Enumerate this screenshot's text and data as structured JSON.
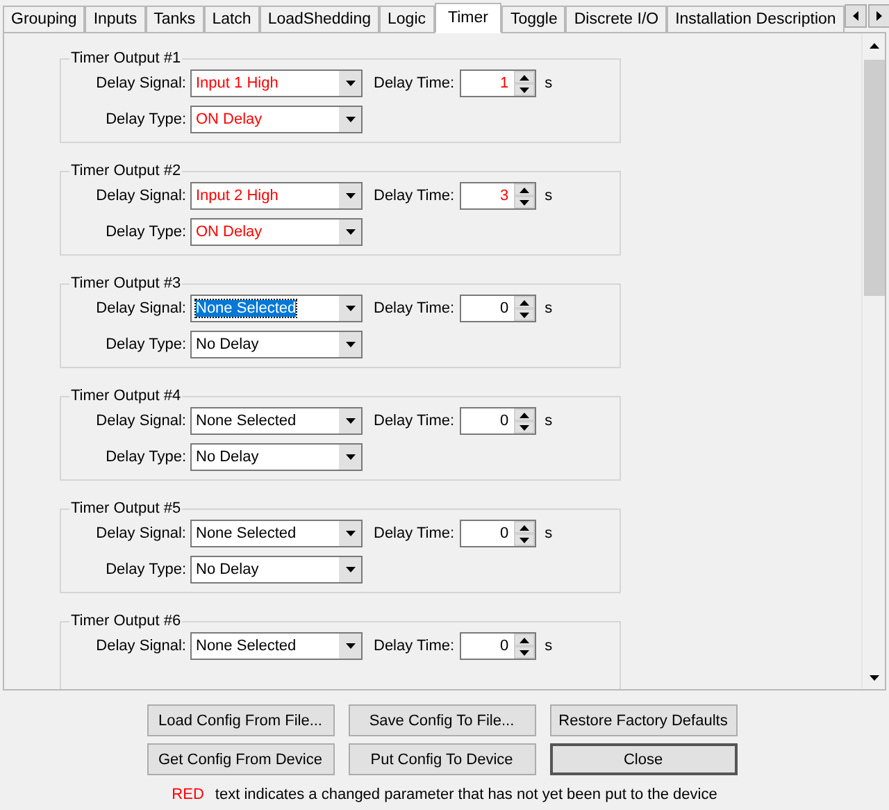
{
  "tabs": [
    {
      "label": "Grouping",
      "selected": false
    },
    {
      "label": "Inputs",
      "selected": false
    },
    {
      "label": "Tanks",
      "selected": false
    },
    {
      "label": "Latch",
      "selected": false
    },
    {
      "label": "LoadShedding",
      "selected": false
    },
    {
      "label": "Logic",
      "selected": false
    },
    {
      "label": "Timer",
      "selected": true
    },
    {
      "label": "Toggle",
      "selected": false
    },
    {
      "label": "Discrete I/O",
      "selected": false
    },
    {
      "label": "Installation Description",
      "selected": false
    }
  ],
  "timers": [
    {
      "title": "Timer Output #1",
      "signal_label": "Delay Signal:",
      "signal": {
        "value": "Input 1 High",
        "changed": true,
        "selected": false
      },
      "time_label": "Delay Time:",
      "time": {
        "value": "1",
        "changed": true
      },
      "unit": "s",
      "type_label": "Delay Type:",
      "type": {
        "value": "ON Delay",
        "changed": true
      }
    },
    {
      "title": "Timer Output #2",
      "signal_label": "Delay Signal:",
      "signal": {
        "value": "Input 2 High",
        "changed": true,
        "selected": false
      },
      "time_label": "Delay Time:",
      "time": {
        "value": "3",
        "changed": true
      },
      "unit": "s",
      "type_label": "Delay Type:",
      "type": {
        "value": "ON Delay",
        "changed": true
      }
    },
    {
      "title": "Timer Output #3",
      "signal_label": "Delay Signal:",
      "signal": {
        "value": "None Selected",
        "changed": false,
        "selected": true
      },
      "time_label": "Delay Time:",
      "time": {
        "value": "0",
        "changed": false
      },
      "unit": "s",
      "type_label": "Delay Type:",
      "type": {
        "value": "No Delay",
        "changed": false
      }
    },
    {
      "title": "Timer Output #4",
      "signal_label": "Delay Signal:",
      "signal": {
        "value": "None Selected",
        "changed": false,
        "selected": false
      },
      "time_label": "Delay Time:",
      "time": {
        "value": "0",
        "changed": false
      },
      "unit": "s",
      "type_label": "Delay Type:",
      "type": {
        "value": "No Delay",
        "changed": false
      }
    },
    {
      "title": "Timer Output #5",
      "signal_label": "Delay Signal:",
      "signal": {
        "value": "None Selected",
        "changed": false,
        "selected": false
      },
      "time_label": "Delay Time:",
      "time": {
        "value": "0",
        "changed": false
      },
      "unit": "s",
      "type_label": "Delay Type:",
      "type": {
        "value": "No Delay",
        "changed": false
      }
    },
    {
      "title": "Timer Output #6",
      "signal_label": "Delay Signal:",
      "signal": {
        "value": "None Selected",
        "changed": false,
        "selected": false
      },
      "time_label": "Delay Time:",
      "time": {
        "value": "0",
        "changed": false
      },
      "unit": "s"
    }
  ],
  "buttons": [
    {
      "label": "Load Config From File..."
    },
    {
      "label": "Save Config To File..."
    },
    {
      "label": "Restore Factory Defaults"
    },
    {
      "label": "Get Config From Device"
    },
    {
      "label": "Put Config To Device"
    },
    {
      "label": "Close",
      "default": true
    }
  ],
  "legend": {
    "keyword": "RED",
    "text": "text indicates a changed parameter that has not yet been put to the device"
  }
}
